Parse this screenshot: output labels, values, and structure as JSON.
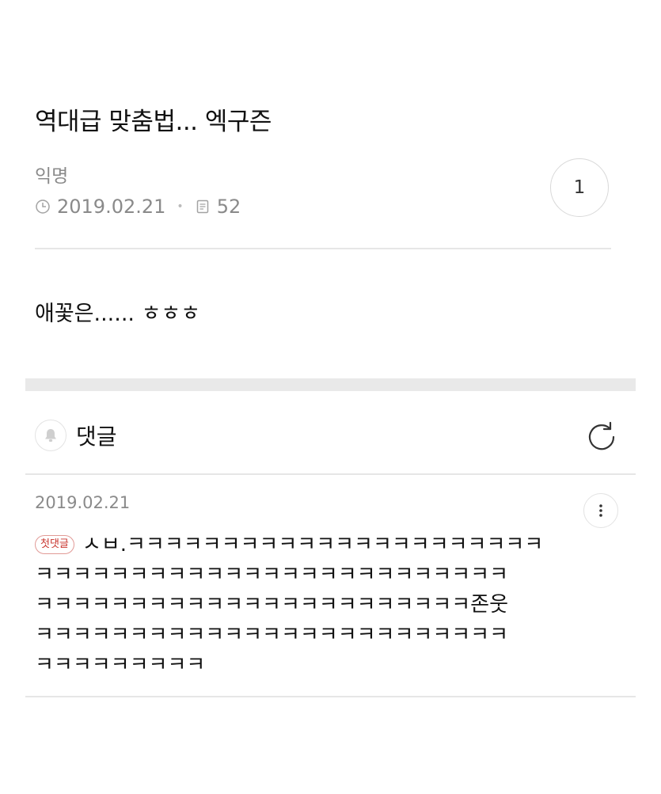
{
  "post": {
    "title": "역대급 맞춤법... 엑구즌",
    "author": "익명",
    "date": "2019.02.21",
    "views": "52",
    "likes": "1",
    "body": "애꽃은...... ㅎㅎㅎ"
  },
  "comments": {
    "header_label": "댓글",
    "items": [
      {
        "date": "2019.02.21",
        "badge": "첫댓글",
        "lines": [
          "ㅅㅂ.ㅋㅋㅋㅋㅋㅋㅋㅋㅋㅋㅋㅋㅋㅋㅋㅋㅋㅋㅋㅋㅋㅋ",
          "ㅋㅋㅋㅋㅋㅋㅋㅋㅋㅋㅋㅋㅋㅋㅋㅋㅋㅋㅋㅋㅋㅋㅋㅋㅋ",
          "ㅋㅋㅋㅋㅋㅋㅋㅋㅋㅋㅋㅋㅋㅋㅋㅋㅋㅋㅋㅋㅋㅋㅋ존웃",
          "ㅋㅋㅋㅋㅋㅋㅋㅋㅋㅋㅋㅋㅋㅋㅋㅋㅋㅋㅋㅋㅋㅋㅋㅋㅋ",
          "ㅋㅋㅋㅋㅋㅋㅋㅋㅋ"
        ]
      }
    ]
  },
  "icons": {
    "clock": "clock-icon",
    "views": "document-icon",
    "bell": "bell-icon",
    "refresh": "refresh-icon",
    "more": "more-vertical-icon"
  },
  "colors": {
    "badge": "#c9352e",
    "muted_text": "#8a8a8a",
    "divider": "#e6e6e6",
    "section_band": "#e9e9e9"
  }
}
